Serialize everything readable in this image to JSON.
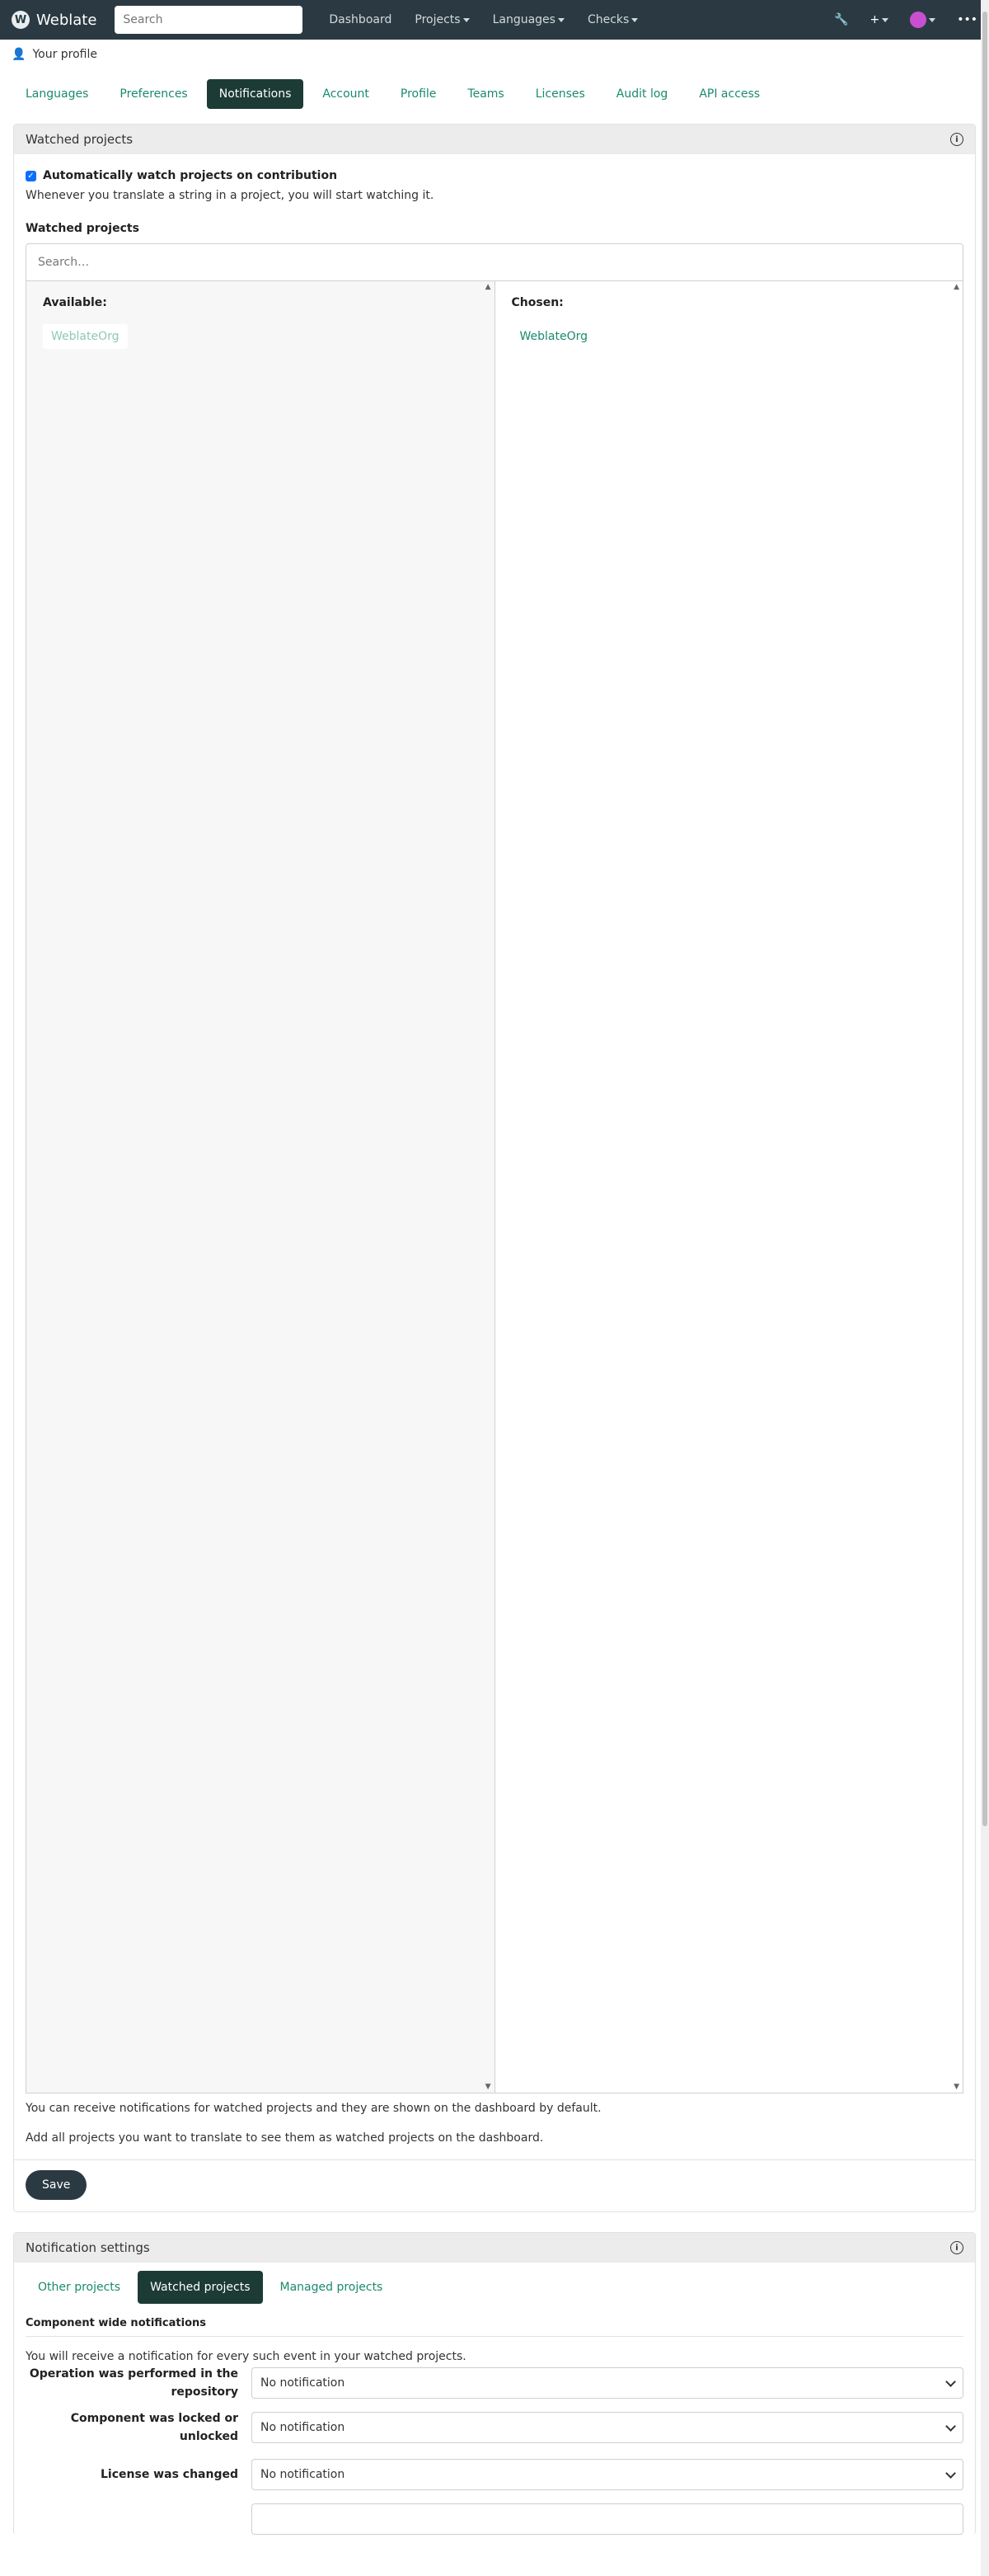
{
  "navbar": {
    "brand": "Weblate",
    "search_placeholder": "Search",
    "links": [
      "Dashboard",
      "Projects",
      "Languages",
      "Checks"
    ],
    "more": "•••"
  },
  "breadcrumb": {
    "label": "Your profile"
  },
  "tabs": [
    "Languages",
    "Preferences",
    "Notifications",
    "Account",
    "Profile",
    "Teams",
    "Licenses",
    "Audit log",
    "API access"
  ],
  "watched": {
    "header": "Watched projects",
    "checkbox_label": "Automatically watch projects on contribution",
    "checkbox_help": "Whenever you translate a string in a project, you will start watching it.",
    "field_label": "Watched projects",
    "search_placeholder": "Search…",
    "available_title": "Available:",
    "available_item": "WeblateOrg",
    "chosen_title": "Chosen:",
    "chosen_item": "WeblateOrg",
    "help1": "You can receive notifications for watched projects and they are shown on the dashboard by default.",
    "help2": "Add all projects you want to translate to see them as watched projects on the dashboard.",
    "save": "Save"
  },
  "notification_settings": {
    "header": "Notification settings",
    "tabs": [
      "Other projects",
      "Watched projects",
      "Managed projects"
    ],
    "section_title": "Component wide notifications",
    "section_help": "You will receive a notification for every such event in your watched projects.",
    "rows": [
      {
        "label": "Operation was performed in the repository",
        "value": "No notification"
      },
      {
        "label": "Component was locked or unlocked",
        "value": "No notification"
      },
      {
        "label": "License was changed",
        "value": "No notification"
      }
    ]
  },
  "colors": {
    "navbar": "#2b3a42",
    "accent": "#1a8a6e",
    "active_tab": "#1c3b35"
  }
}
